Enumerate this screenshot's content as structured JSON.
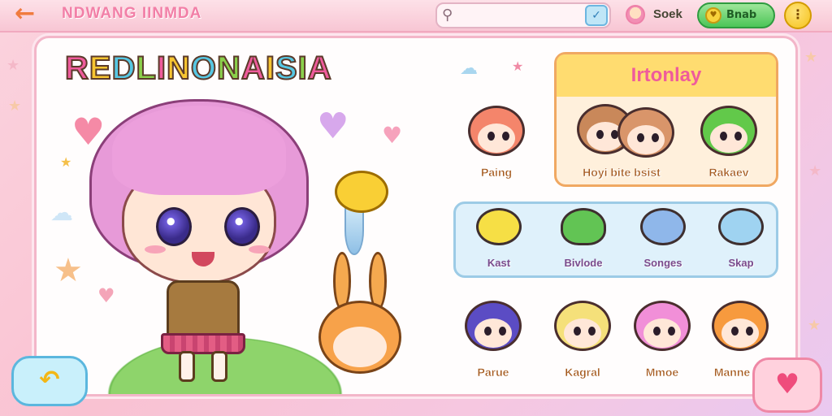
{
  "topbar": {
    "title": "NDWANG IINMDA",
    "search": {
      "placeholder": "",
      "value": ""
    },
    "user_name": "Soek",
    "coin_label": "Bnab",
    "icons": {
      "back": "back-arrow-icon",
      "search": "search-icon",
      "search_go": "checkmark-icon",
      "menu": "menu-icon",
      "coin": "coin-icon"
    }
  },
  "main": {
    "title": "REDLINONAISIA",
    "title_letters": [
      "R",
      "E",
      "D",
      "L",
      "I",
      "N",
      "O",
      "N",
      "A",
      "I",
      "S",
      "I",
      "A"
    ]
  },
  "favorites_card": {
    "title": "Irtonlay",
    "items": [
      {
        "label": "Hoyi bite bsist",
        "hair_color": "#c9885a"
      },
      {
        "label": "Rakaev",
        "hair_color": "#62c94a"
      }
    ]
  },
  "characters_top": [
    {
      "label": "Paing",
      "hair_color": "#f4856b"
    }
  ],
  "pets_card": {
    "items": [
      {
        "label": "Kast",
        "color": "#f6df45"
      },
      {
        "label": "Bivlode",
        "color": "#62c454"
      },
      {
        "label": "Songes",
        "color": "#8fb7ea"
      },
      {
        "label": "Skap",
        "color": "#9fd3f1"
      }
    ]
  },
  "characters_bottom": [
    {
      "label": "Parue",
      "hair_color": "#5b4cc4"
    },
    {
      "label": "Kagral",
      "hair_color": "#f5e07a"
    },
    {
      "label": "Mmoe",
      "hair_color": "#f18fd8"
    },
    {
      "label": "Manne",
      "hair_color": "#f79a3e"
    }
  ],
  "colors": {
    "accent_pink": "#ef5b9c",
    "accent_green": "#4cc557",
    "accent_yellow": "#f5c21c",
    "panel_border": "#f3b6c9"
  }
}
